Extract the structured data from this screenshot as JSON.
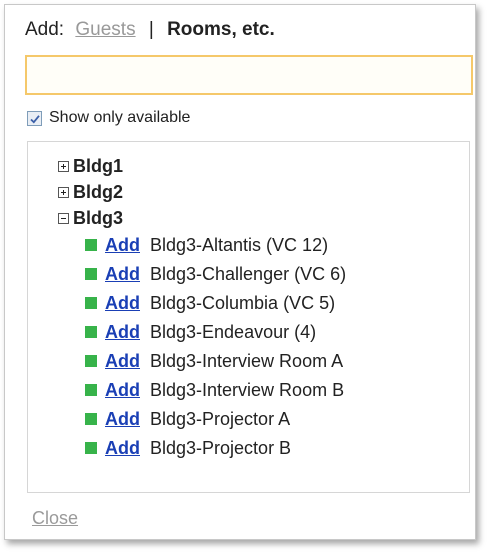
{
  "header": {
    "add_label": "Add:",
    "guests_link": "Guests",
    "separator": "|",
    "rooms_label": "Rooms, etc."
  },
  "search": {
    "value": "",
    "placeholder": ""
  },
  "filter": {
    "show_only_available_label": "Show only available",
    "checked": true
  },
  "tree": {
    "nodes": [
      {
        "label": "Bldg1",
        "state": "collapsed"
      },
      {
        "label": "Bldg2",
        "state": "collapsed"
      },
      {
        "label": "Bldg3",
        "state": "expanded"
      }
    ],
    "rooms": [
      {
        "add": "Add",
        "name": "Bldg3-Altantis (VC 12)"
      },
      {
        "add": "Add",
        "name": "Bldg3-Challenger (VC 6)"
      },
      {
        "add": "Add",
        "name": "Bldg3-Columbia (VC 5)"
      },
      {
        "add": "Add",
        "name": "Bldg3-Endeavour (4)"
      },
      {
        "add": "Add",
        "name": "Bldg3-Interview Room A"
      },
      {
        "add": "Add",
        "name": "Bldg3-Interview Room B"
      },
      {
        "add": "Add",
        "name": "Bldg3-Projector A"
      },
      {
        "add": "Add",
        "name": "Bldg3-Projector B"
      }
    ],
    "availability_color": "#37b34a"
  },
  "footer": {
    "close_label": "Close"
  }
}
